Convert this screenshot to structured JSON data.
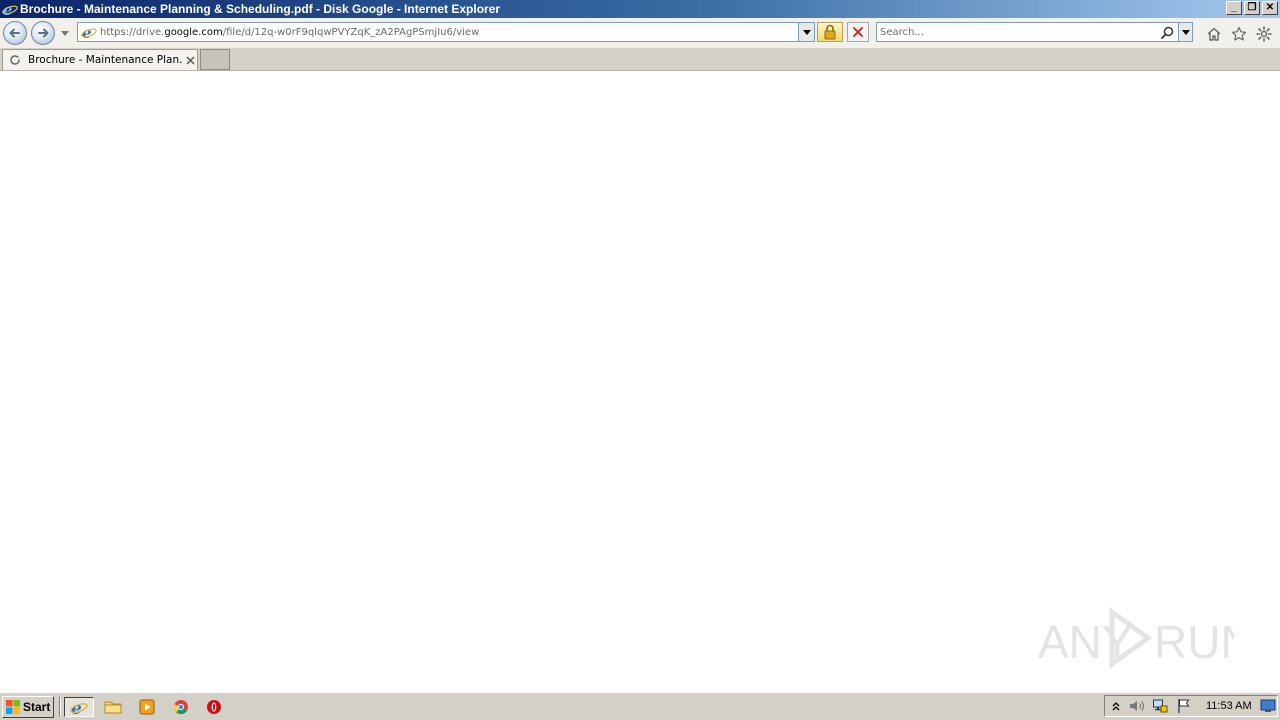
{
  "window": {
    "title": "Brochure - Maintenance Planning & Scheduling.pdf - Disk Google - Internet Explorer",
    "controls": [
      "minimize-icon",
      "restore-icon",
      "close-icon"
    ]
  },
  "address": {
    "url_prefix": "https://drive.",
    "url_host": "google.com",
    "url_path": "/file/d/12q-w0rF9qlqwPVYZqK_zA2PAgPSmjIu6/view"
  },
  "search": {
    "placeholder": "Search..."
  },
  "tabs": [
    {
      "title": "Brochure - Maintenance Plan...",
      "state": "loading"
    }
  ],
  "watermark": {
    "text_left": "ANY",
    "text_right": "RUN"
  },
  "taskbar": {
    "start_label": "Start",
    "pinned": [
      "internet-explorer-icon",
      "file-explorer-icon",
      "media-player-icon",
      "chrome-icon",
      "opera-icon"
    ],
    "tray": [
      "show-hidden-icons-icon",
      "volume-icon",
      "network-icon",
      "action-center-flag-icon"
    ],
    "clock": "11:53 AM"
  },
  "colors": {
    "titlebar_start": "#0a246a",
    "titlebar_end": "#a6caf0",
    "chrome_gray": "#d4d0c8",
    "ie_blue": "#1d6fd1"
  }
}
